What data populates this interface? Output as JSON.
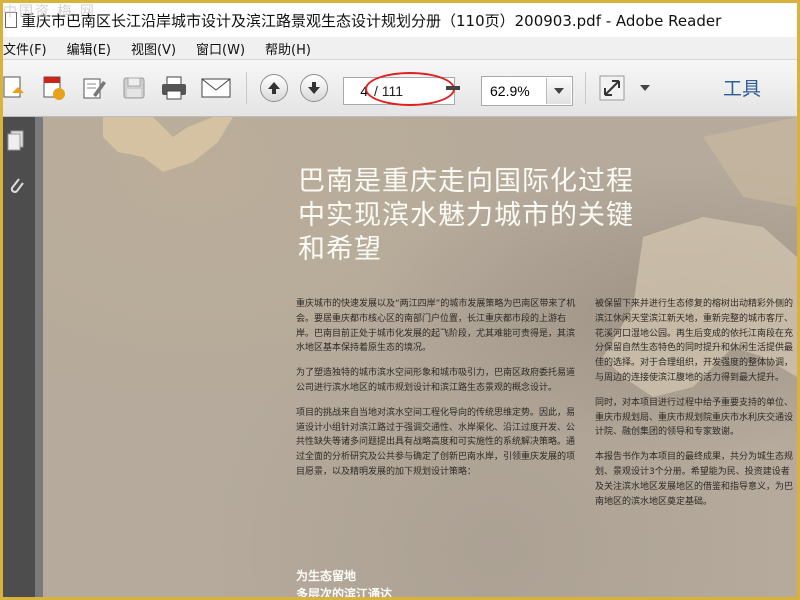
{
  "window": {
    "watermark": "中国资 梅 网",
    "title": "重庆市巴南区长江沿岸城市设计及滨江路景观生态设计规划分册（110页）200903.pdf - Adobe Reader"
  },
  "menu": [
    "文件(F)",
    "编辑(E)",
    "视图(V)",
    "窗口(W)",
    "帮助(H)"
  ],
  "toolbar": {
    "current_page": "4",
    "total_pages": "/ 111",
    "zoom": "62.9%",
    "tools_label": "工具"
  },
  "icons": {
    "left": [
      "create-pdf-icon",
      "share-icon",
      "edit-icon",
      "save-icon",
      "print-icon",
      "email-icon"
    ],
    "nav": [
      "page-up-icon",
      "page-down-icon"
    ]
  },
  "document": {
    "headline": "巴南是重庆走向国际化过程中实现滨水魅力城市的关键和希望",
    "col1": [
      "重庆城市的快速发展以及“两江四岸”的城市发展策略为巴南区带来了机会。要居重庆都市核心区的南部门户位置，长江重庆都市段的上游右岸。巴南目前正处于城市化发展的起飞阶段，尤其难能可贵得是，其滨水地区基本保持着原生态的境况。",
      "为了塑造独特的城市滨水空间形象和城市吸引力，巴南区政府委托易道公司进行滨水地区的城市规划设计和滨江路生态景观的概念设计。",
      "项目的挑战来自当地对滨水空间工程化导向的传统思维定势。因此，易道设计小组针对滨江路过于强调交通性、水岸渠化、沿江过度开发、公共性缺失等诸多问题提出具有战略高度和可实施性的系统解决策略。通过全面的分析研究及公共参与确定了创新巴南水岸，引领重庆发展的项目愿景，以及精明发展的加下规划设计策略："
    ],
    "col2": [
      "被保留下来并进行生态修复的榕树出动精彩外侧的滨江休闲天堂滨江新天地，重新完整的城市客厅、花溪河口湿地公园。再生后变成的依托江南段在充分保留自然生态特色的同时提升和休闲生活提供最佳的选择。对于合理组织，开发强度的整体协调，与周边的连接使滨江腹地的活力得到最大提升。",
      "同时，对本项目进行过程中给予重要支持的单位、重庆市规划局、重庆市规划院重庆市水利庆交通设计院、融创集团的领导和专家致谢。",
      "本报告书作为本项目的最终成果，共分为城生态规划、景观设计3个分册。希望能为民、投资建设者及关注滨水地区发展地区的借鉴和指导意义，为巴南地区的滨水地区奠定基础。"
    ],
    "sub": [
      "为生态留地",
      "多层次的滨江通达"
    ]
  }
}
